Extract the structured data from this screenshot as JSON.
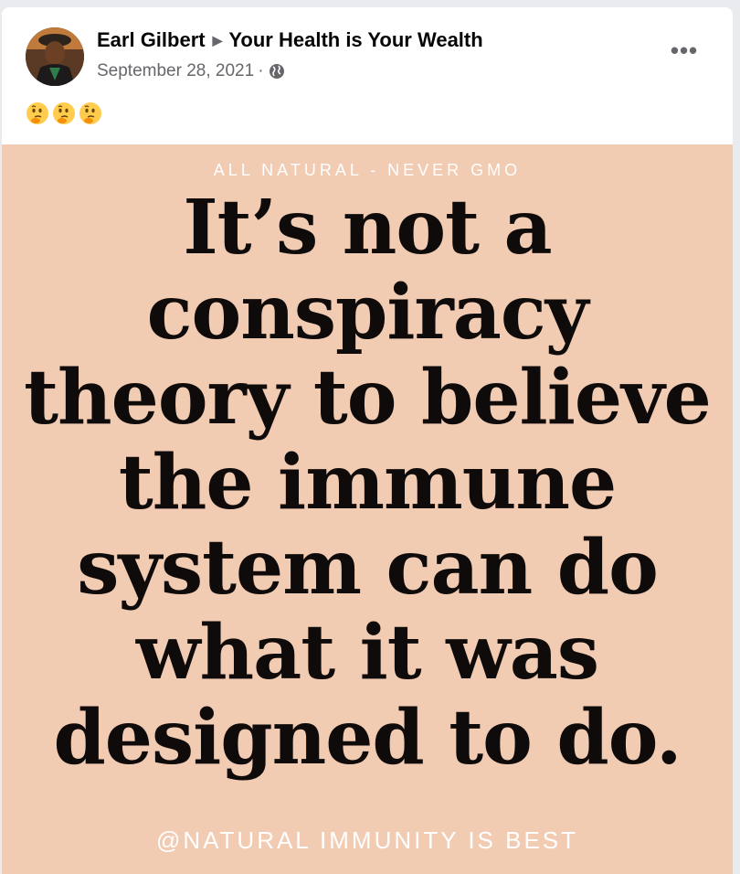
{
  "post": {
    "author": "Earl Gilbert",
    "group": "Your Health is Your Wealth",
    "date": "September 28, 2021",
    "separator": "·",
    "privacy_icon": "globe-icon",
    "more_label": "•••",
    "reactions_text": [
      "thinking-face-emoji",
      "thinking-face-emoji",
      "thinking-face-emoji"
    ]
  },
  "image": {
    "background_color": "#f2cbb3",
    "tagline_top": "ALL NATURAL - NEVER GMO",
    "quote_lines": [
      "It’s not a",
      "conspiracy",
      "theory to believe",
      "the immune",
      "system can do",
      "what it was",
      "designed to do."
    ],
    "tagline_bottom": "@NATURAL IMMUNITY IS BEST"
  }
}
